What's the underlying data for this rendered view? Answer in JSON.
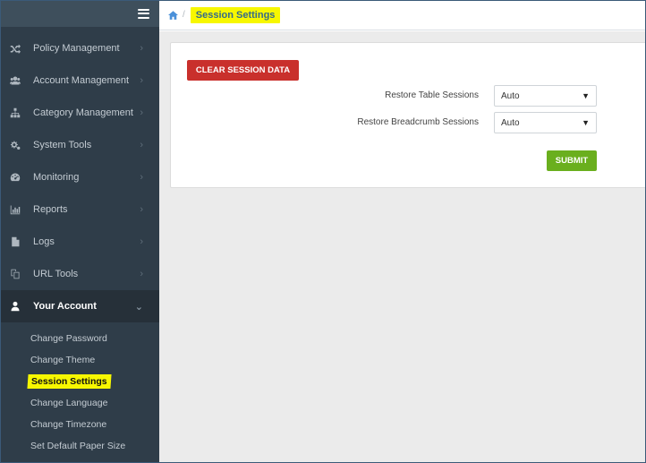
{
  "breadcrumb": {
    "home_icon": "home-icon",
    "separator": "/",
    "current": "Session Settings"
  },
  "sidebar": {
    "menu_icon": "hamburger-menu-icon",
    "items": [
      {
        "label": "Policy Management",
        "icon": "shuffle-icon"
      },
      {
        "label": "Account Management",
        "icon": "users-icon"
      },
      {
        "label": "Category Management",
        "icon": "sitemap-icon"
      },
      {
        "label": "System Tools",
        "icon": "gears-icon"
      },
      {
        "label": "Monitoring",
        "icon": "dashboard-icon"
      },
      {
        "label": "Reports",
        "icon": "bar-chart-icon"
      },
      {
        "label": "Logs",
        "icon": "file-icon"
      },
      {
        "label": "URL Tools",
        "icon": "copy-icon"
      },
      {
        "label": "Your Account",
        "icon": "user-icon"
      }
    ],
    "chevron_right": "›",
    "chevron_down": "⌄",
    "submenu": [
      {
        "label": "Change Password"
      },
      {
        "label": "Change Theme"
      },
      {
        "label": "Session Settings"
      },
      {
        "label": "Change Language"
      },
      {
        "label": "Change Timezone"
      },
      {
        "label": "Set Default Paper Size"
      }
    ]
  },
  "form": {
    "clear_button": "CLEAR SESSION DATA",
    "restore_table": {
      "label": "Restore Table Sessions",
      "value": "Auto"
    },
    "restore_breadcrumb": {
      "label": "Restore Breadcrumb Sessions",
      "value": "Auto"
    },
    "select_arrow": "▼",
    "submit_button": "SUBMIT"
  },
  "colors": {
    "sidebar_bg": "#2f3d49",
    "active_bg": "#263039",
    "highlight": "#f7f700",
    "danger": "#c9302c",
    "success": "#6aaf1e",
    "link": "#4a90d9"
  }
}
